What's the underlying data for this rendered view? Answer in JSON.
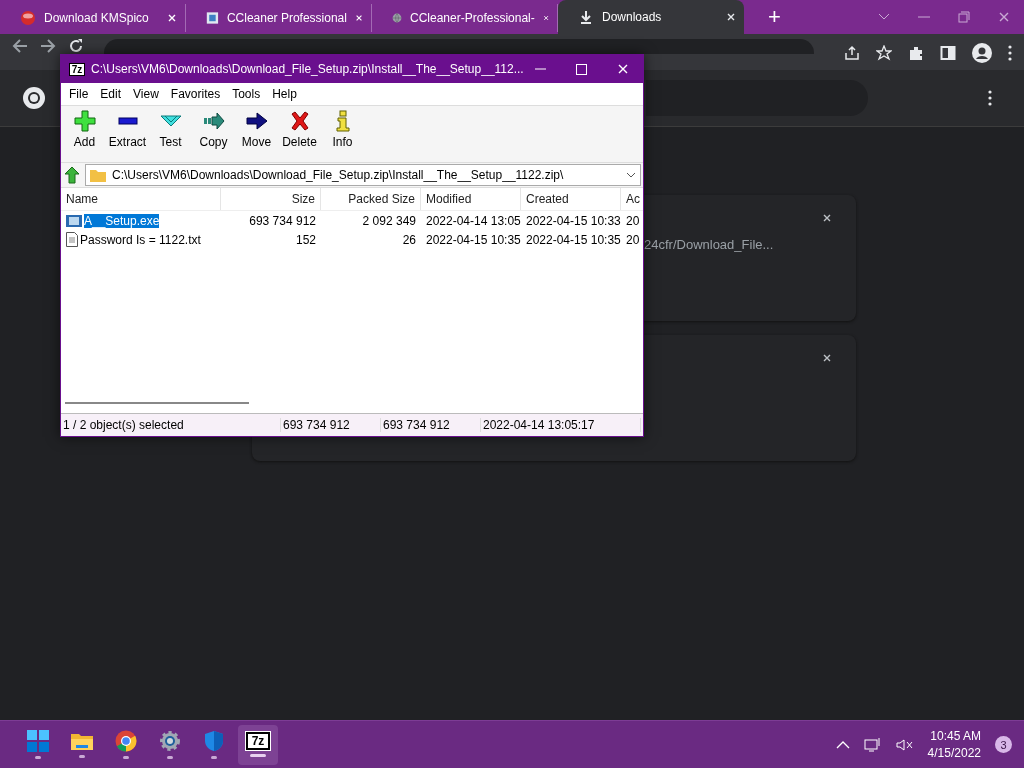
{
  "browser": {
    "tabs": [
      {
        "kind": "red-disc",
        "title": "Download KMSpico",
        "selected": false
      },
      {
        "kind": "app",
        "title": "CCleaner Professional",
        "selected": false
      },
      {
        "kind": "globe",
        "title": "CCleaner-Professional-",
        "selected": false
      },
      {
        "kind": "download",
        "title": "Downloads",
        "selected": true
      }
    ],
    "new_tab": "+"
  },
  "downloads": {
    "cards": [
      {
        "kind": "url",
        "url": "24cfr/Download_File..."
      },
      {
        "kind": "blank"
      }
    ]
  },
  "archive_window": {
    "icon_text": "7z",
    "title": "C:\\Users\\VM6\\Downloads\\Download_File_Setup.zip\\Install__The__Setup__112...",
    "menu": [
      "File",
      "Edit",
      "View",
      "Favorites",
      "Tools",
      "Help"
    ],
    "toolbar": [
      {
        "kind": "add",
        "label": "Add"
      },
      {
        "kind": "extract",
        "label": "Extract"
      },
      {
        "kind": "test",
        "label": "Test"
      },
      {
        "kind": "copy",
        "label": "Copy"
      },
      {
        "kind": "move",
        "label": "Move"
      },
      {
        "kind": "delete",
        "label": "Delete"
      },
      {
        "kind": "info",
        "label": "Info"
      }
    ],
    "path": "C:\\Users\\VM6\\Downloads\\Download_File_Setup.zip\\Install__The__Setup__1122.zip\\",
    "columns": [
      "Name",
      "Size",
      "Packed Size",
      "Modified",
      "Created",
      "Ac"
    ],
    "rows": [
      {
        "kind": "exe",
        "selected": true,
        "cells": [
          "A__Setup.exe",
          "693 734 912",
          "2 092 349",
          "2022-04-14 13:05",
          "2022-04-15 10:33",
          "20"
        ]
      },
      {
        "kind": "txt",
        "selected": false,
        "cells": [
          "Password Is =   1122.txt",
          "152",
          "26",
          "2022-04-15 10:35",
          "2022-04-15 10:35",
          "20"
        ]
      }
    ],
    "status_bar": [
      "1 / 2 object(s) selected",
      "693 734 912",
      "693 734 912",
      "2022-04-14 13:05:17"
    ]
  },
  "taskbar": {
    "apps": [
      {
        "kind": "start",
        "active": false
      },
      {
        "kind": "folder",
        "active": false
      },
      {
        "kind": "chrome",
        "active": false
      },
      {
        "kind": "gear",
        "active": false
      },
      {
        "kind": "shield",
        "active": false
      },
      {
        "kind": "archive",
        "label": "7z",
        "active": true
      }
    ],
    "time": "10:45 AM",
    "date": "4/15/2022",
    "notifications": "3"
  }
}
